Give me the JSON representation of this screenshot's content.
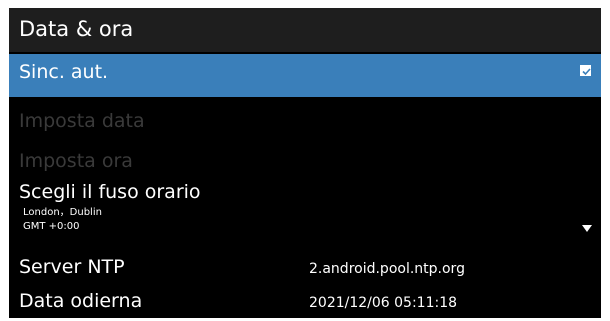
{
  "header": {
    "title": "Data & ora"
  },
  "items": {
    "auto_sync": {
      "label": "Sinc. aut.",
      "checked": true
    },
    "set_date": {
      "label": "Imposta data"
    },
    "set_time": {
      "label": "Imposta ora"
    },
    "timezone": {
      "label": "Scegli il fuso orario",
      "city": "London，Dublin",
      "offset": "GMT +0:00"
    },
    "ntp_server": {
      "label": "Server NTP",
      "value": "2.android.pool.ntp.org"
    },
    "current_date": {
      "label": "Data odierna",
      "value": "2021/12/06 05:11:18"
    }
  },
  "colors": {
    "selected": "#3a7fba",
    "header": "#1e1e1e",
    "disabled_text": "#3a3a3a",
    "background": "#000000"
  }
}
